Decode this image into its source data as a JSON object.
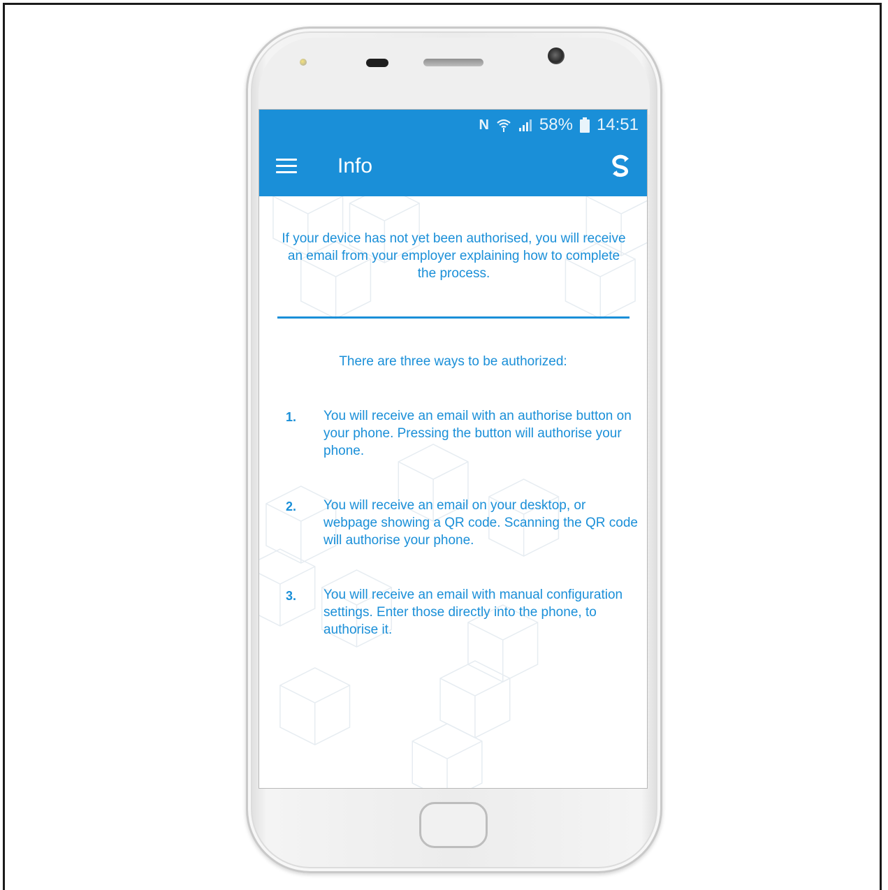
{
  "status_bar": {
    "nfc_icon": "N",
    "wifi_icon": "wifi-icon",
    "signal_icon": "signal-icon",
    "battery_percent": "58%",
    "battery_icon": "battery-icon",
    "time": "14:51"
  },
  "app_bar": {
    "title": "Info",
    "menu_icon": "hamburger-menu-icon",
    "action_icon": "sync-icon"
  },
  "content": {
    "intro": "If your device has not yet been authorised, you will receive an email from your employer explaining how to complete the process.",
    "ways_heading": "There are three ways to be authorized:",
    "steps": [
      {
        "number": "1.",
        "text": "You will receive an email with an authorise button on your phone. Pressing the button will authorise your phone."
      },
      {
        "number": "2.",
        "text": "You will receive an email on your desktop, or webpage showing a QR code. Scanning the QR code will authorise your phone."
      },
      {
        "number": "3.",
        "text": "You will receive an email with manual configuration settings. Enter those directly into the phone, to authorise it."
      }
    ]
  },
  "colors": {
    "accent": "#1a8fd8",
    "background": "#ffffff"
  }
}
